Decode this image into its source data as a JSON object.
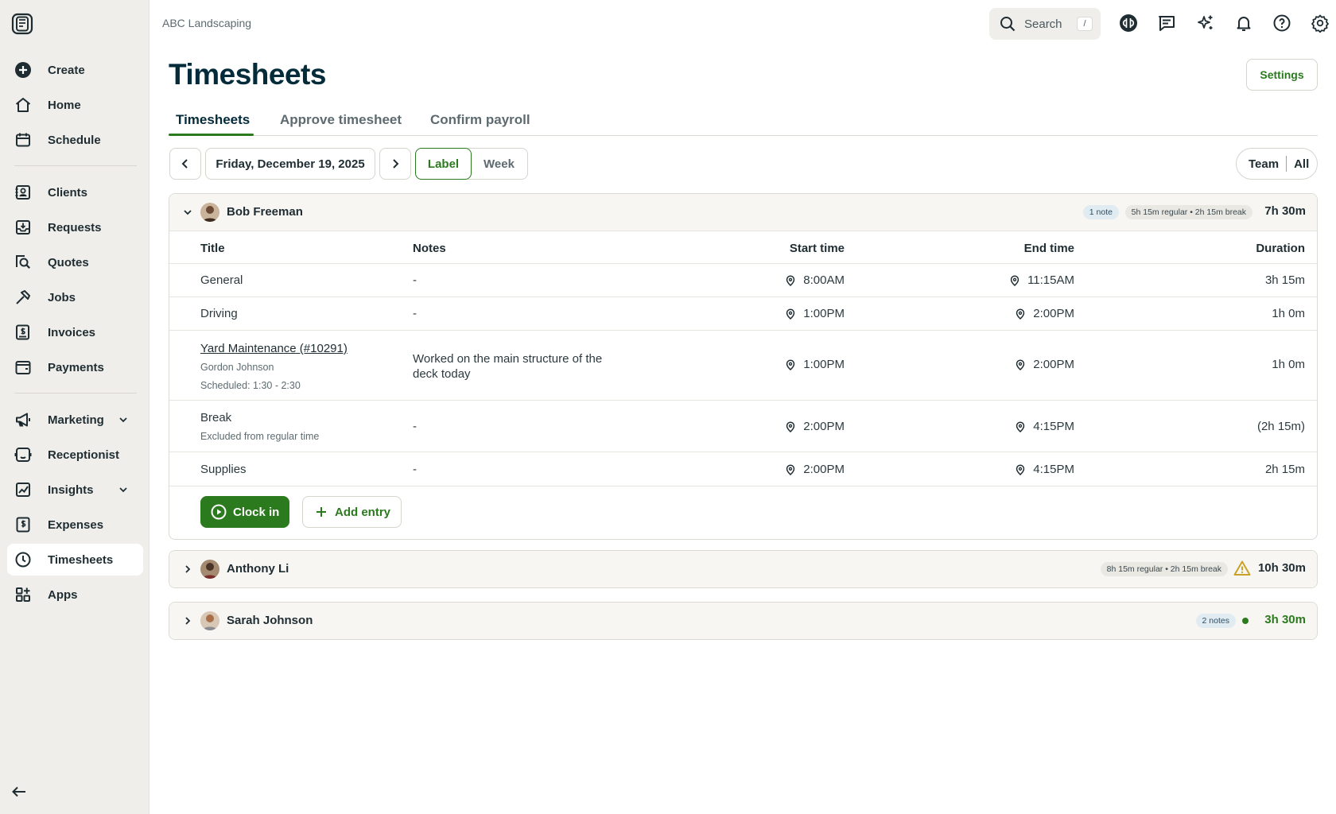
{
  "app": {
    "company": "ABC Landscaping"
  },
  "search": {
    "label": "Search",
    "shortcut": "/"
  },
  "sidebar": {
    "items": [
      {
        "label": "Create",
        "icon": "plus-circle-icon"
      },
      {
        "label": "Home",
        "icon": "home-icon"
      },
      {
        "label": "Schedule",
        "icon": "calendar-icon"
      },
      {
        "label": "Clients",
        "icon": "clients-icon"
      },
      {
        "label": "Requests",
        "icon": "requests-icon"
      },
      {
        "label": "Quotes",
        "icon": "quotes-icon"
      },
      {
        "label": "Jobs",
        "icon": "hammer-icon"
      },
      {
        "label": "Invoices",
        "icon": "invoice-icon"
      },
      {
        "label": "Payments",
        "icon": "payments-icon"
      },
      {
        "label": "Marketing",
        "icon": "megaphone-icon"
      },
      {
        "label": "Receptionist",
        "icon": "receptionist-icon"
      },
      {
        "label": "Insights",
        "icon": "insights-icon"
      },
      {
        "label": "Expenses",
        "icon": "expenses-icon"
      },
      {
        "label": "Timesheets",
        "icon": "clock-icon",
        "active": true
      },
      {
        "label": "Apps",
        "icon": "apps-icon"
      }
    ]
  },
  "page": {
    "title": "Timesheets",
    "settings_label": "Settings",
    "tabs": [
      "Timesheets",
      "Approve timesheet",
      "Confirm payroll"
    ]
  },
  "toolbar": {
    "date": "Friday, December 19, 2025",
    "view_label": "Label",
    "view_week": "Week",
    "filter_team": "Team",
    "filter_all": "All"
  },
  "columns": {
    "title": "Title",
    "notes": "Notes",
    "start": "Start time",
    "end": "End time",
    "duration": "Duration"
  },
  "employees": [
    {
      "name": "Bob Freeman",
      "notes_badge": "1 note",
      "summary": "5h 15m regular • 2h 15m break",
      "total": "7h 30m",
      "entries": [
        {
          "title": "General",
          "notes": "-",
          "start": "8:00AM",
          "end": "11:15AM",
          "duration": "3h 15m"
        },
        {
          "title": "Driving",
          "notes": "-",
          "start": "1:00PM",
          "end": "2:00PM",
          "duration": "1h 0m"
        },
        {
          "title": "Yard Maintenance (#10291)",
          "client": "Gordon Johnson",
          "scheduled": "Scheduled: 1:30 - 2:30",
          "notes": "Worked on the main structure of the deck today",
          "start": "1:00PM",
          "end": "2:00PM",
          "duration": "1h 0m"
        },
        {
          "title": "Break",
          "sub": "Excluded from regular time",
          "notes": "-",
          "start": "2:00PM",
          "end": "4:15PM",
          "duration": "(2h 15m)"
        },
        {
          "title": "Supplies",
          "notes": "-",
          "start": "2:00PM",
          "end": "4:15PM",
          "duration": "2h 15m"
        }
      ],
      "clock_in_label": "Clock in",
      "add_entry_label": "Add entry"
    },
    {
      "name": "Anthony Li",
      "summary": "8h 15m regular • 2h 15m break",
      "total": "10h 30m"
    },
    {
      "name": "Sarah Johnson",
      "notes_badge": "2 notes",
      "total": "3h 30m"
    }
  ],
  "colors": {
    "brand_green": "#2b7a1e",
    "title_navy": "#032b3a",
    "sidebar_bg": "#efeeea",
    "warning": "#c9a227"
  }
}
